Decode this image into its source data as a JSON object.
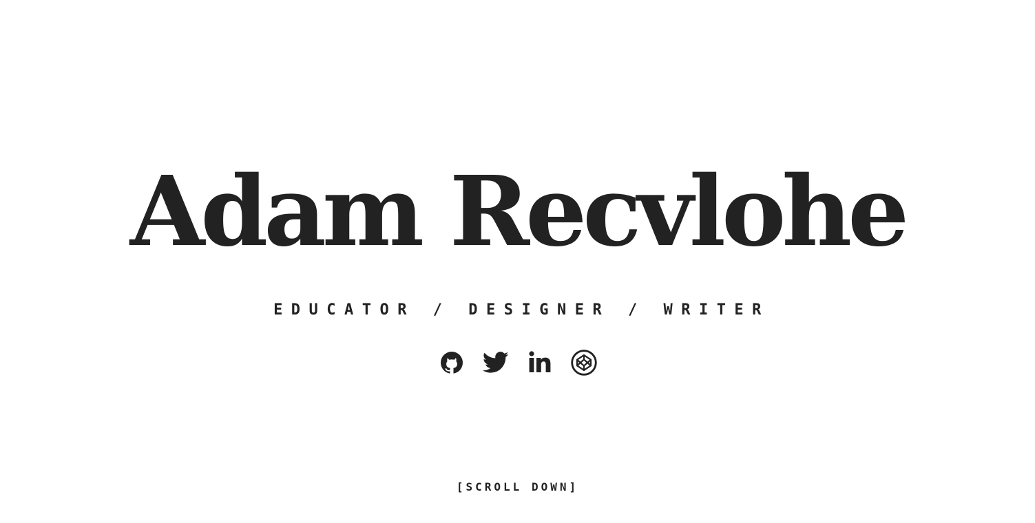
{
  "hero": {
    "name": "Adam Recvlohe",
    "tagline": "EDUCATOR / DESIGNER / WRITER",
    "scroll_label": "[SCROLL DOWN]"
  },
  "socials": [
    {
      "icon": "github-icon",
      "label": "GitHub"
    },
    {
      "icon": "twitter-icon",
      "label": "Twitter"
    },
    {
      "icon": "linkedin-icon",
      "label": "LinkedIn"
    },
    {
      "icon": "codepen-icon",
      "label": "CodePen"
    }
  ],
  "colors": {
    "text": "#222222",
    "background": "#ffffff"
  }
}
